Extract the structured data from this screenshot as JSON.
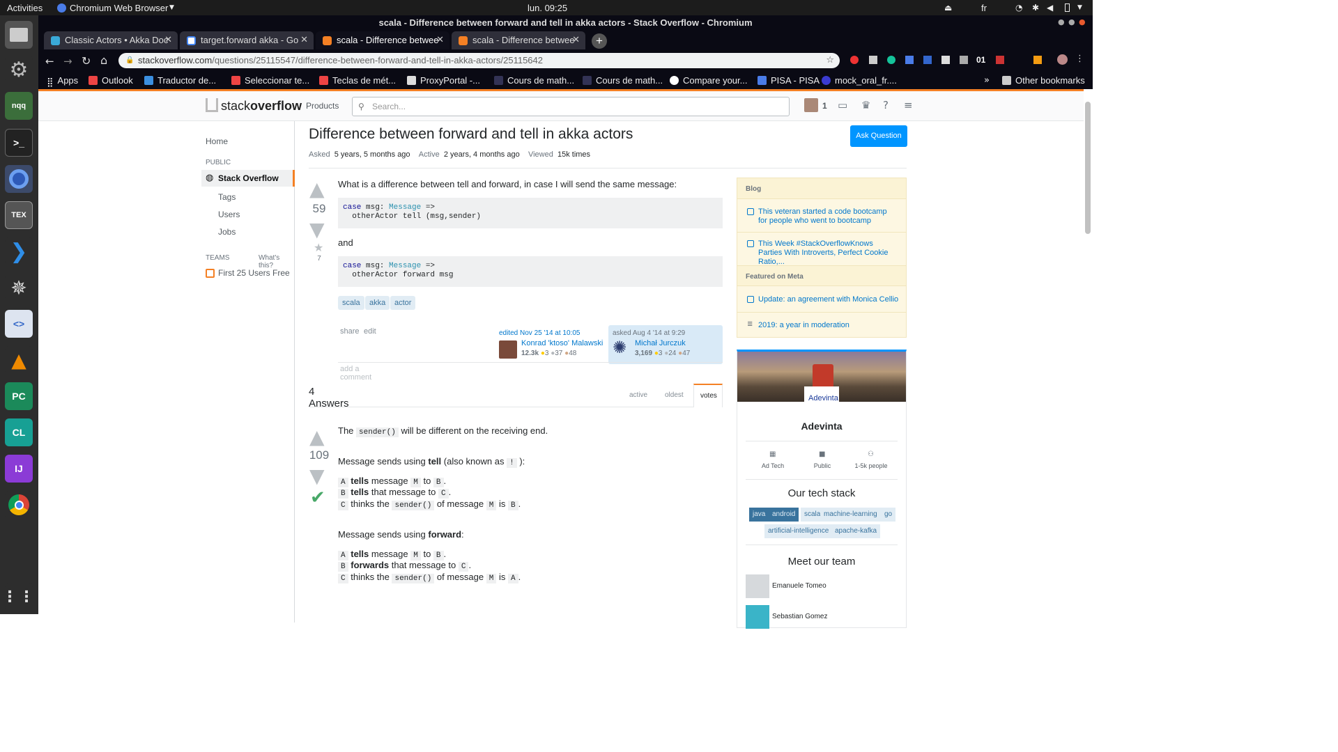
{
  "os": {
    "activities": "Activities",
    "app_menu": "Chromium Web Browser",
    "clock": "lun. 09:25",
    "lang": "fr"
  },
  "window": {
    "title": "scala - Difference between forward and tell in akka actors - Stack Overflow - Chromium"
  },
  "tabs": [
    {
      "label": "Classic Actors • Akka Doc"
    },
    {
      "label": "target.forward akka - Go"
    },
    {
      "label": "scala - Difference betwee"
    },
    {
      "label": "scala - Difference betwee"
    }
  ],
  "address": {
    "domain": "stackoverflow.com",
    "path": "/questions/25115547/difference-between-forward-and-tell-in-akka-actors/25115642"
  },
  "bookmarks": {
    "apps": "Apps",
    "items": [
      "Outlook",
      "Traductor de...",
      "Seleccionar te...",
      "Teclas de mét...",
      "ProxyPortal -...",
      "Cours de math...",
      "Cours de math...",
      "Compare your...",
      "PISA - PISA",
      "mock_oral_fr...."
    ],
    "other": "Other bookmarks",
    "ext_time": "01"
  },
  "dock": {
    "nqq": "nqq",
    "tex": "TEX",
    "pc": "PC",
    "cl": "CL",
    "ij": "IJ"
  },
  "so": {
    "logo_a": "stack",
    "logo_b": "overflow",
    "products": "Products",
    "search_placeholder": "Search...",
    "rep": "1",
    "nav": {
      "home": "Home",
      "public": "PUBLIC",
      "stack_overflow": "Stack Overflow",
      "tags": "Tags",
      "users": "Users",
      "jobs": "Jobs",
      "teams": "TEAMS",
      "whats_this": "What's this?",
      "first25": "First 25 Users Free"
    },
    "question": {
      "title": "Difference between forward and tell in akka actors",
      "ask_button": "Ask Question",
      "asked_label": "Asked",
      "asked_value": "5 years, 5 months ago",
      "active_label": "Active",
      "active_value": "2 years, 4 months ago",
      "viewed_label": "Viewed",
      "viewed_value": "15k times",
      "votes": "59",
      "favorites": "7",
      "body_text": "What is a difference between tell and forward, in case I will send the same message:",
      "and": "and",
      "code1_l1_kw": "case",
      "code1_l1_mid": " msg: ",
      "code1_l1_type": "Message",
      "code1_l1_end": " =>",
      "code1_l2": "  otherActor tell (msg,sender)",
      "code2_l1_kw": "case",
      "code2_l1_mid": " msg: ",
      "code2_l1_type": "Message",
      "code2_l1_end": " =>",
      "code2_l2": "  otherActor forward msg",
      "tags": [
        "scala",
        "akka",
        "actor"
      ],
      "share": "share",
      "edit": "edit",
      "edited": "edited Nov 25 '14 at 10:05",
      "editor_name": "Konrad 'ktoso' Malawski",
      "editor_rep": "12.3k",
      "editor_gold": "3",
      "editor_silver": "37",
      "editor_bronze": "48",
      "asked_meta": "asked Aug 4 '14 at 9:29",
      "asker_name": "Michał Jurczuk",
      "asker_rep": "3,169",
      "asker_gold": "3",
      "asker_silver": "24",
      "asker_bronze": "47",
      "add_comment": "add a comment"
    },
    "answers": {
      "count": "4 Answers",
      "sort_active": "active",
      "sort_oldest": "oldest",
      "sort_votes": "votes",
      "votes": "109",
      "p1_a": "The ",
      "p1_code": "sender()",
      "p1_b": " will be different on the receiving end.",
      "p2_a": "Message sends using ",
      "p2_bold": "tell",
      "p2_b": " (also known as ",
      "p2_code": "!",
      "p2_c": " ):",
      "t1_a": "A",
      "t1_bold": "tells",
      "t1_b": " message ",
      "t1_m": "M",
      "t1_c": " to ",
      "t1_d": "B",
      "t1_e": ".",
      "t2_a": "B",
      "t2_bold": "tells",
      "t2_b": " that message to ",
      "t2_c": "C",
      "t2_d": ".",
      "t3_a": "C",
      "t3_b": " thinks the ",
      "t3_code": "sender()",
      "t3_c": " of message ",
      "t3_m": "M",
      "t3_d": " is ",
      "t3_e": "B",
      "t3_f": ".",
      "p3_a": "Message sends using ",
      "p3_bold": "forward",
      "p3_b": ":",
      "f1_a": "A",
      "f1_bold": "tells",
      "f1_b": " message ",
      "f1_m": "M",
      "f1_c": " to ",
      "f1_d": "B",
      "f1_e": ".",
      "f2_a": "B",
      "f2_bold": "forwards",
      "f2_b": " that message to ",
      "f2_c": "C",
      "f2_d": ".",
      "f3_a": "C",
      "f3_b": " thinks the ",
      "f3_code": "sender()",
      "f3_c": " of message ",
      "f3_m": "M",
      "f3_d": " is ",
      "f3_e": "A",
      "f3_f": "."
    },
    "sidebar": {
      "blog": "Blog",
      "blog1": "This veteran started a code bootcamp for people who went to bootcamp",
      "blog2": "This Week #StackOverflowKnows Parties With Introverts, Perfect Cookie Ratio,...",
      "meta": "Featured on Meta",
      "meta1": "Update: an agreement with Monica Cellio",
      "meta2": "2019: a year in moderation",
      "company_logo": "Adevinta",
      "company": "Adevinta",
      "ad_tech": "Ad Tech",
      "public": "Public",
      "people": "1-5k people",
      "stack_title": "Our tech stack",
      "tech": [
        "java",
        "android",
        "scala",
        "machine-learning",
        "go",
        "artificial-intelligence",
        "apache-kafka"
      ],
      "team_title": "Meet our team",
      "member1": "Emanuele Tomeo",
      "member2": "Sebastian Gomez"
    }
  }
}
